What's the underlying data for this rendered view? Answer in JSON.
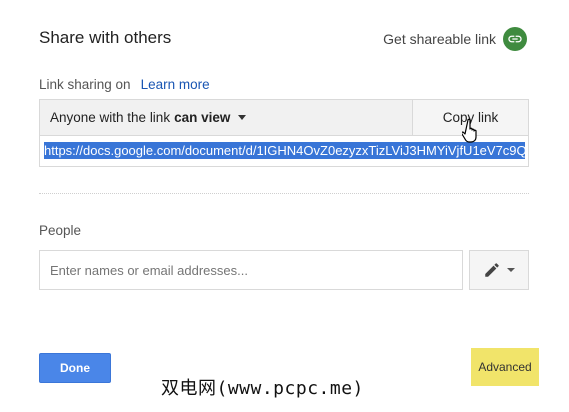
{
  "dialog": {
    "title": "Share with others",
    "get_link_label": "Get shareable link",
    "link_sharing_label": "Link sharing on",
    "learn_more": "Learn more",
    "permission": {
      "prefix": "Anyone with the link",
      "level": "can view"
    },
    "copy_link_label": "Copy link",
    "share_url": "https://docs.google.com/document/d/1IGHN4OvZ0ezyzxTizLViJ3HMYiVjfU1eV7c9Q",
    "people_label": "People",
    "people_input": {
      "value": "",
      "placeholder": "Enter names or email addresses..."
    },
    "done_label": "Done",
    "advanced_label": "Advanced"
  },
  "watermark": "双电网(www.pcpc.me)",
  "icons": {
    "get_link": "link-icon",
    "dropdown": "caret-down-icon",
    "edit": "pencil-icon",
    "pointer": "hand-cursor-icon"
  },
  "colors": {
    "link_blue": "#1a56b3",
    "done_blue": "#4a86e8",
    "link_icon_green": "#3f8b3f",
    "url_selection": "#3875d7",
    "advanced_highlight": "#f1e46a"
  }
}
